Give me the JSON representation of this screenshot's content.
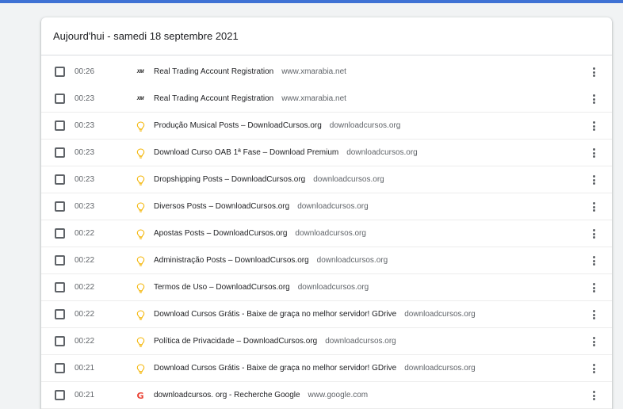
{
  "header": {
    "date_label": "Aujourd'hui - samedi 18 septembre 2021"
  },
  "colors": {
    "accent_bar": "#3f72d4",
    "bulb": "#f4b400",
    "google": "#ea4335"
  },
  "rows": [
    {
      "time": "00:26",
      "icon": "xm-icon",
      "icon_text": "XM",
      "title": "Real Trading Account Registration",
      "domain": "www.xmarabia.net"
    },
    {
      "time": "00:23",
      "icon": "xm-icon",
      "icon_text": "XM",
      "title": "Real Trading Account Registration",
      "domain": "www.xmarabia.net"
    },
    {
      "time": "00:23",
      "icon": "lightbulb-icon",
      "title": "Produção Musical Posts – DownloadCursos.org",
      "domain": "downloadcursos.org"
    },
    {
      "time": "00:23",
      "icon": "lightbulb-icon",
      "title": "Download Curso OAB 1ª Fase – Download Premium",
      "domain": "downloadcursos.org"
    },
    {
      "time": "00:23",
      "icon": "lightbulb-icon",
      "title": "Dropshipping Posts – DownloadCursos.org",
      "domain": "downloadcursos.org"
    },
    {
      "time": "00:23",
      "icon": "lightbulb-icon",
      "title": "Diversos Posts – DownloadCursos.org",
      "domain": "downloadcursos.org"
    },
    {
      "time": "00:22",
      "icon": "lightbulb-icon",
      "title": "Apostas Posts – DownloadCursos.org",
      "domain": "downloadcursos.org"
    },
    {
      "time": "00:22",
      "icon": "lightbulb-icon",
      "title": "Administração Posts – DownloadCursos.org",
      "domain": "downloadcursos.org"
    },
    {
      "time": "00:22",
      "icon": "lightbulb-icon",
      "title": "Termos de Uso – DownloadCursos.org",
      "domain": "downloadcursos.org"
    },
    {
      "time": "00:22",
      "icon": "lightbulb-icon",
      "title": "Download Cursos Grátis - Baixe de graça no melhor servidor! GDrive",
      "domain": "downloadcursos.org"
    },
    {
      "time": "00:22",
      "icon": "lightbulb-icon",
      "title": "Política de Privacidade – DownloadCursos.org",
      "domain": "downloadcursos.org"
    },
    {
      "time": "00:21",
      "icon": "lightbulb-icon",
      "title": "Download Cursos Grátis - Baixe de graça no melhor servidor! GDrive",
      "domain": "downloadcursos.org"
    },
    {
      "time": "00:21",
      "icon": "google-icon",
      "icon_text": "G",
      "title": "downloadcursos. org - Recherche Google",
      "domain": "www.google.com"
    }
  ]
}
